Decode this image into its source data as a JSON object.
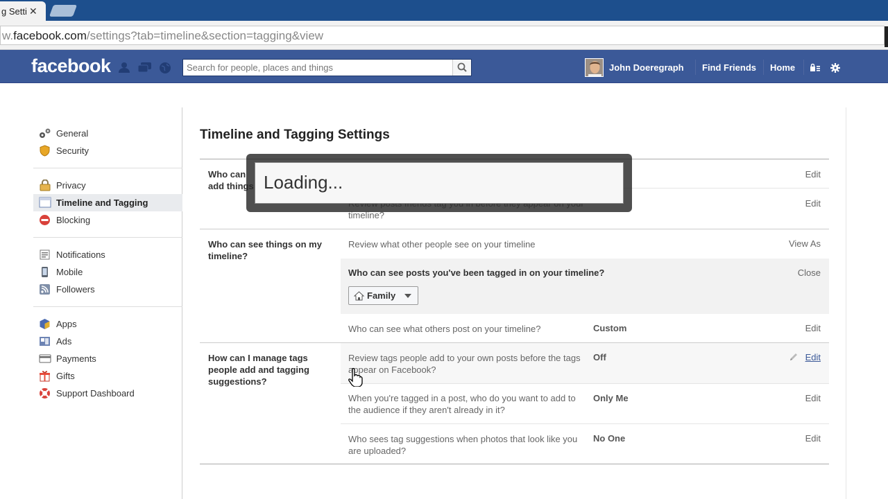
{
  "browser": {
    "tab_title": "g Setti",
    "tab_close": "✕",
    "url_prefix": "w.",
    "url_host": "facebook.com",
    "url_path": "/settings?tab=timeline&section=tagging&view"
  },
  "topbar": {
    "logo": "facebook",
    "search_placeholder": "Search for people, places and things",
    "user_name": "John Doeregraph",
    "find_friends": "Find Friends",
    "home": "Home"
  },
  "sidebar": {
    "groups": [
      [
        {
          "label": "General",
          "icon": "gears-icon"
        },
        {
          "label": "Security",
          "icon": "shield-icon"
        }
      ],
      [
        {
          "label": "Privacy",
          "icon": "lock-icon"
        },
        {
          "label": "Timeline and Tagging",
          "icon": "timeline-icon",
          "active": true
        },
        {
          "label": "Blocking",
          "icon": "block-icon"
        }
      ],
      [
        {
          "label": "Notifications",
          "icon": "globe-icon"
        },
        {
          "label": "Mobile",
          "icon": "phone-icon"
        },
        {
          "label": "Followers",
          "icon": "rss-icon"
        }
      ],
      [
        {
          "label": "Apps",
          "icon": "cube-icon"
        },
        {
          "label": "Ads",
          "icon": "ads-icon"
        },
        {
          "label": "Payments",
          "icon": "card-icon"
        },
        {
          "label": "Gifts",
          "icon": "gift-icon"
        },
        {
          "label": "Support Dashboard",
          "icon": "lifebuoy-icon"
        }
      ]
    ]
  },
  "main": {
    "title": "Timeline and Tagging Settings",
    "section1": {
      "label": "Who can add things to my timeline?",
      "row1_action": "Edit",
      "row2_question": "Review posts friends tag you in before they appear on your timeline?",
      "row2_action": "Edit"
    },
    "section2": {
      "label": "Who can see things on my timeline?",
      "row1_question": "Review what other people see on your timeline",
      "row1_action": "View As",
      "expanded_title": "Who can see posts you've been tagged in on your timeline?",
      "expanded_close": "Close",
      "audience": "Family",
      "row3_question": "Who can see what others post on your timeline?",
      "row3_value": "Custom",
      "row3_action": "Edit"
    },
    "section3": {
      "label": "How can I manage tags people add and tagging suggestions?",
      "row1_question": "Review tags people add to your own posts before the tags appear on Facebook?",
      "row1_value": "Off",
      "row1_action": "Edit",
      "row2_question": "When you're tagged in a post, who do you want to add to the audience if they aren't already in it?",
      "row2_value": "Only Me",
      "row2_action": "Edit",
      "row3_question": "Who sees tag suggestions when photos that look like you are uploaded?",
      "row3_value": "No One",
      "row3_action": "Edit"
    }
  },
  "overlay": {
    "loading_text": "Loading..."
  }
}
